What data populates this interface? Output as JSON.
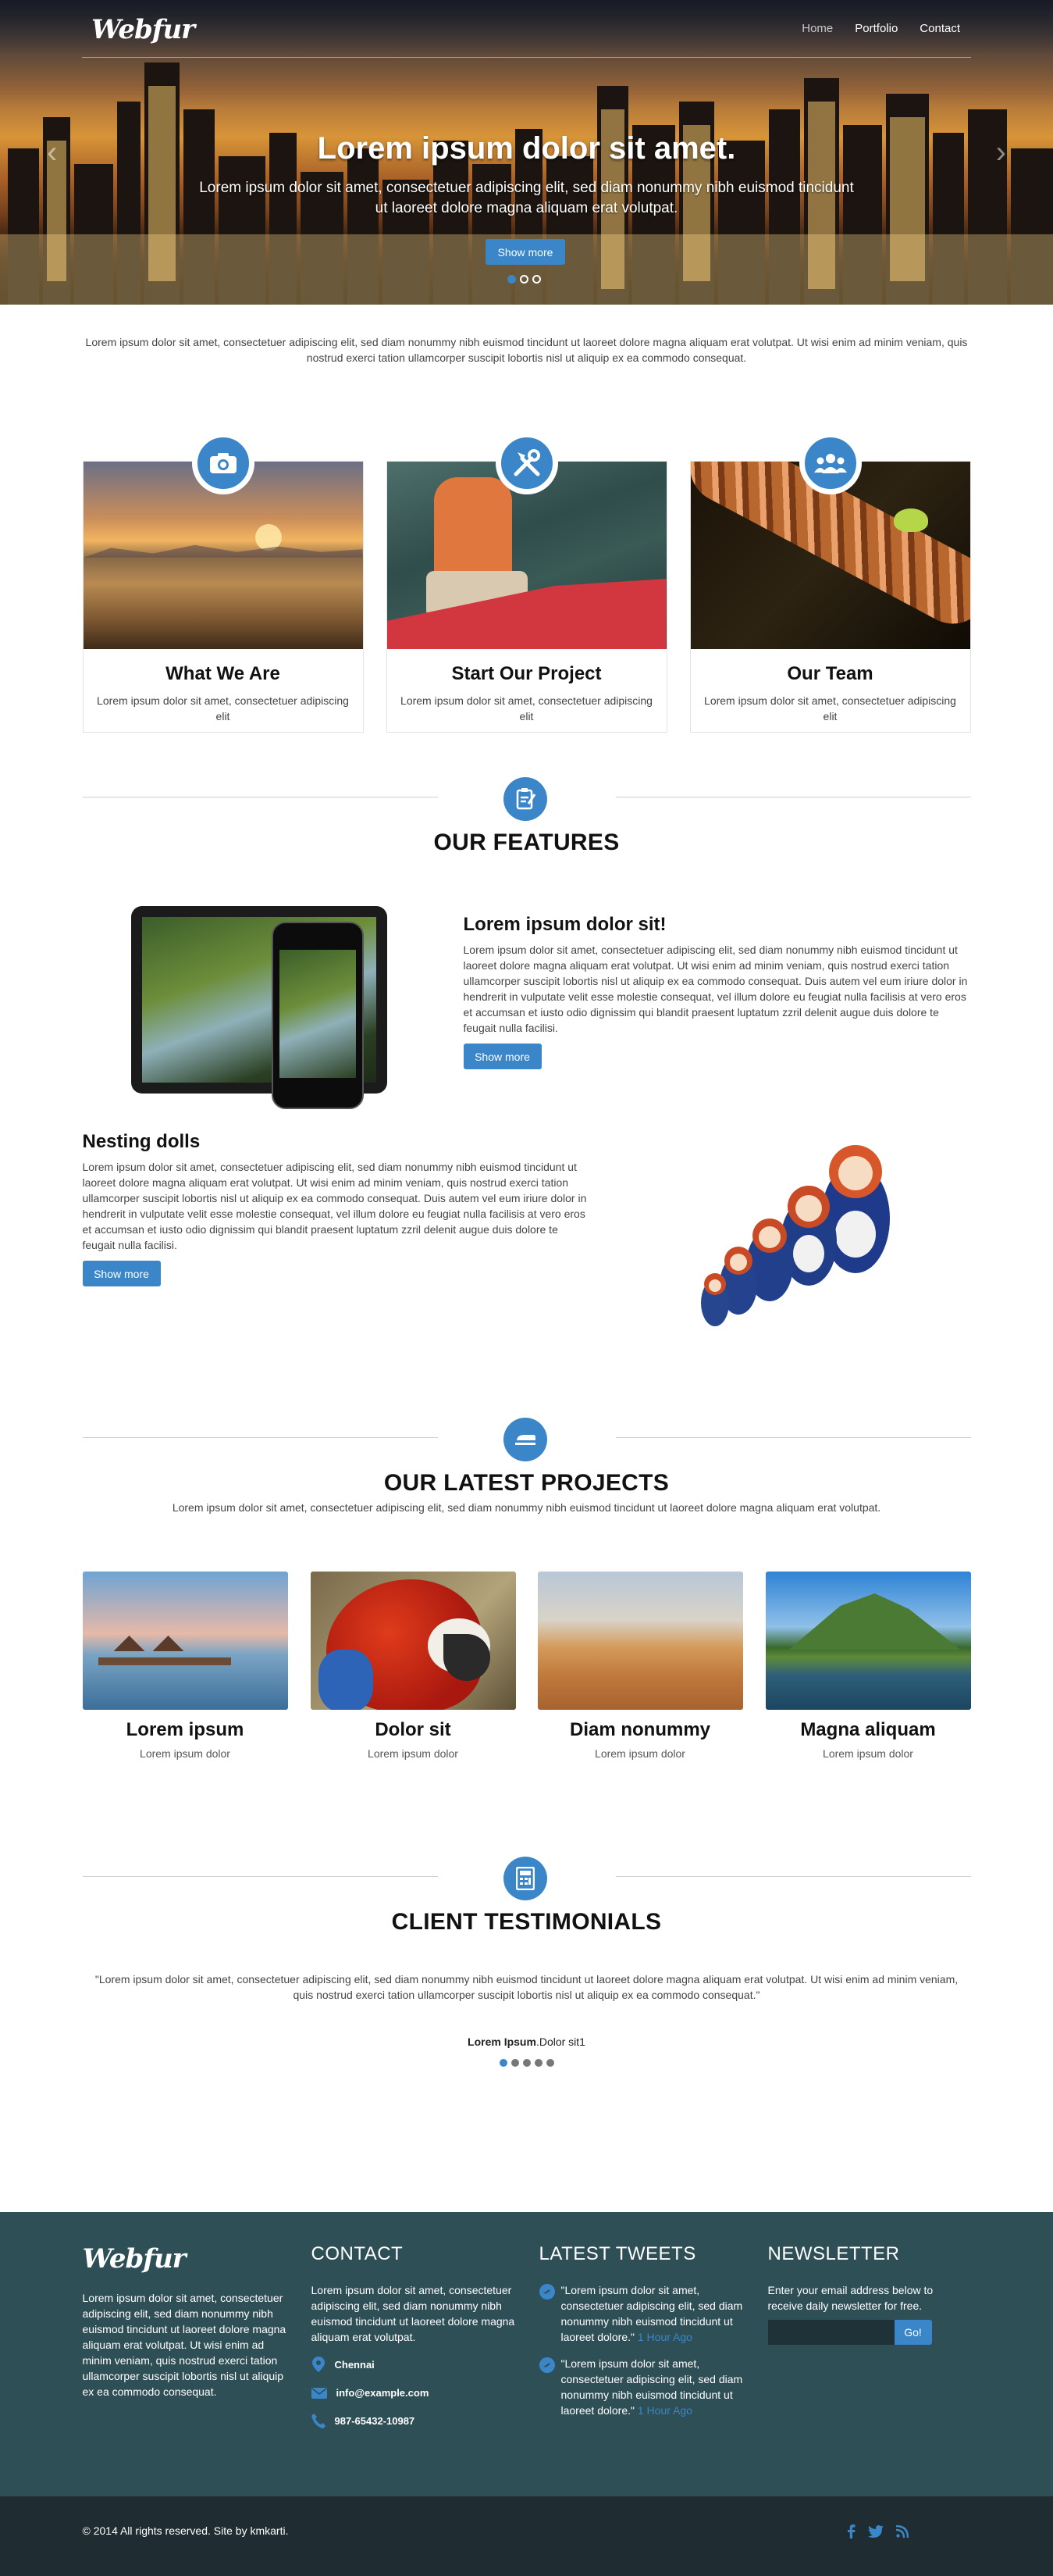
{
  "brand": {
    "logo": "Webfur"
  },
  "nav": {
    "items": [
      {
        "label": "Home",
        "active": true
      },
      {
        "label": "Portfolio"
      },
      {
        "label": "Contact"
      }
    ]
  },
  "hero": {
    "title": "Lorem ipsum dolor sit amet.",
    "text": "Lorem ipsum dolor sit amet, consectetuer adipiscing elit, sed diam nonummy nibh euismod tincidunt ut laoreet dolore magna aliquam erat volutpat.",
    "button": "Show more",
    "slide_count": 3,
    "active_slide": 1
  },
  "intro": "Lorem ipsum dolor sit amet, consectetuer adipiscing elit, sed diam nonummy nibh euismod tincidunt ut laoreet dolore magna aliquam erat volutpat. Ut wisi enim ad minim veniam, quis nostrud exerci tation ullamcorper suscipit lobortis nisl ut aliquip ex ea commodo consequat.",
  "services": [
    {
      "title": "What We Are",
      "text": "Lorem ipsum dolor sit amet, consectetuer adipiscing elit",
      "icon": "camera-icon"
    },
    {
      "title": "Start Our Project",
      "text": "Lorem ipsum dolor sit amet, consectetuer adipiscing elit",
      "icon": "tools-icon"
    },
    {
      "title": "Our Team",
      "text": "Lorem ipsum dolor sit amet, consectetuer adipiscing elit",
      "icon": "team-icon"
    }
  ],
  "features": {
    "heading": "OUR FEATURES",
    "items": [
      {
        "title": "Lorem ipsum dolor sit!",
        "text": "Lorem ipsum dolor sit amet, consectetuer adipiscing elit, sed diam nonummy nibh euismod tincidunt ut laoreet dolore magna aliquam erat volutpat. Ut wisi enim ad minim veniam, quis nostrud exerci tation ullamcorper suscipit lobortis nisl ut aliquip ex ea commodo consequat. Duis autem vel eum iriure dolor in hendrerit in vulputate velit esse molestie consequat, vel illum dolore eu feugiat nulla facilisis at vero eros et accumsan et iusto odio dignissim qui blandit praesent luptatum zzril delenit augue duis dolore te feugait nulla facilisi.",
        "button": "Show more"
      },
      {
        "title": "Nesting dolls",
        "text": "Lorem ipsum dolor sit amet, consectetuer adipiscing elit, sed diam nonummy nibh euismod tincidunt ut laoreet dolore magna aliquam erat volutpat. Ut wisi enim ad minim veniam, quis nostrud exerci tation ullamcorper suscipit lobortis nisl ut aliquip ex ea commodo consequat. Duis autem vel eum iriure dolor in hendrerit in vulputate velit esse molestie consequat, vel illum dolore eu feugiat nulla facilisis at vero eros et accumsan et iusto odio dignissim qui blandit praesent luptatum zzril delenit augue duis dolore te feugait nulla facilisi.",
        "button": "Show more"
      }
    ]
  },
  "projects": {
    "heading": "OUR LATEST PROJECTS",
    "subtitle": "Lorem ipsum dolor sit amet, consectetuer adipiscing elit, sed diam nonummy nibh euismod tincidunt ut laoreet dolore magna aliquam erat volutpat.",
    "items": [
      {
        "title": "Lorem ipsum",
        "text": "Lorem ipsum dolor"
      },
      {
        "title": "Dolor sit",
        "text": "Lorem ipsum dolor"
      },
      {
        "title": "Diam nonummy",
        "text": "Lorem ipsum dolor"
      },
      {
        "title": "Magna aliquam",
        "text": "Lorem ipsum dolor"
      }
    ]
  },
  "testimonials": {
    "heading": "CLIENT TESTIMONIALS",
    "quote": "\"Lorem ipsum dolor sit amet, consectetuer adipiscing elit, sed diam nonummy nibh euismod tincidunt ut laoreet dolore magna aliquam erat volutpat. Ut wisi enim ad minim veniam, quis nostrud exerci tation ullamcorper suscipit lobortis nisl ut aliquip ex ea commodo consequat.\"",
    "author": "Lorem Ipsum",
    "role": "Dolor sit1",
    "dot_count": 5,
    "active_dot": 1
  },
  "footer": {
    "logo": "Webfur",
    "about": "Lorem ipsum dolor sit amet, consectetuer adipiscing elit, sed diam nonummy nibh euismod tincidunt ut laoreet dolore magna aliquam erat volutpat. Ut wisi enim ad minim veniam, quis nostrud exerci tation ullamcorper suscipit lobortis nisl ut aliquip ex ea commodo consequat.",
    "contact": {
      "heading": "CONTACT",
      "text": "Lorem ipsum dolor sit amet, consectetuer adipiscing elit, sed diam nonummy nibh euismod tincidunt ut laoreet dolore magna aliquam erat volutpat.",
      "city": "Chennai",
      "email": "info@example.com",
      "phone": "987-65432-10987"
    },
    "tweets": {
      "heading": "LATEST TWEETS",
      "items": [
        {
          "text": "\"Lorem ipsum dolor sit amet, consectetuer adipiscing elit, sed diam nonummy nibh euismod tincidunt ut laoreet dolore.\"",
          "time": "1 Hour Ago"
        },
        {
          "text": "\"Lorem ipsum dolor sit amet, consectetuer adipiscing elit, sed diam nonummy nibh euismod tincidunt ut laoreet dolore.\"",
          "time": "1 Hour Ago"
        }
      ]
    },
    "newsletter": {
      "heading": "NEWSLETTER",
      "text": "Enter your email address below to receive daily newsletter for free.",
      "placeholder": "",
      "button": "Go!"
    }
  },
  "bottom": {
    "copyright": "© 2014 All rights reserved. Site by kmkarti."
  },
  "colors": {
    "accent": "#3b86c8",
    "footer_bg": "#2f4f57",
    "bottom_bg": "#1f2c31"
  }
}
